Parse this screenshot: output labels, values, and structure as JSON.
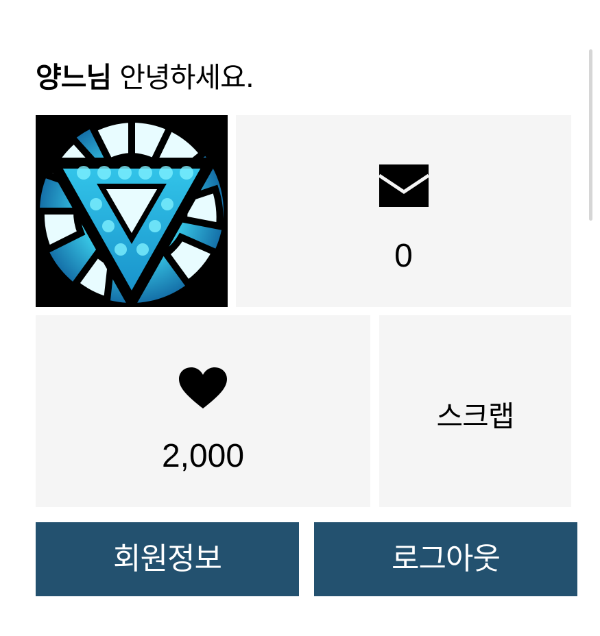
{
  "greeting": {
    "user_name": "양느님",
    "message": "안녕하세요."
  },
  "profile": {
    "avatar_icon": "arc-reactor-avatar"
  },
  "stats": {
    "messages": {
      "icon": "envelope-icon",
      "count": "0"
    },
    "likes": {
      "icon": "heart-icon",
      "count": "2,000"
    },
    "scrap": {
      "label": "스크랩"
    }
  },
  "buttons": {
    "member_info": "회원정보",
    "logout": "로그아웃"
  },
  "colors": {
    "button_background": "#23516f",
    "card_background": "#f5f5f5",
    "avatar_glow": "#3fd8f2"
  }
}
